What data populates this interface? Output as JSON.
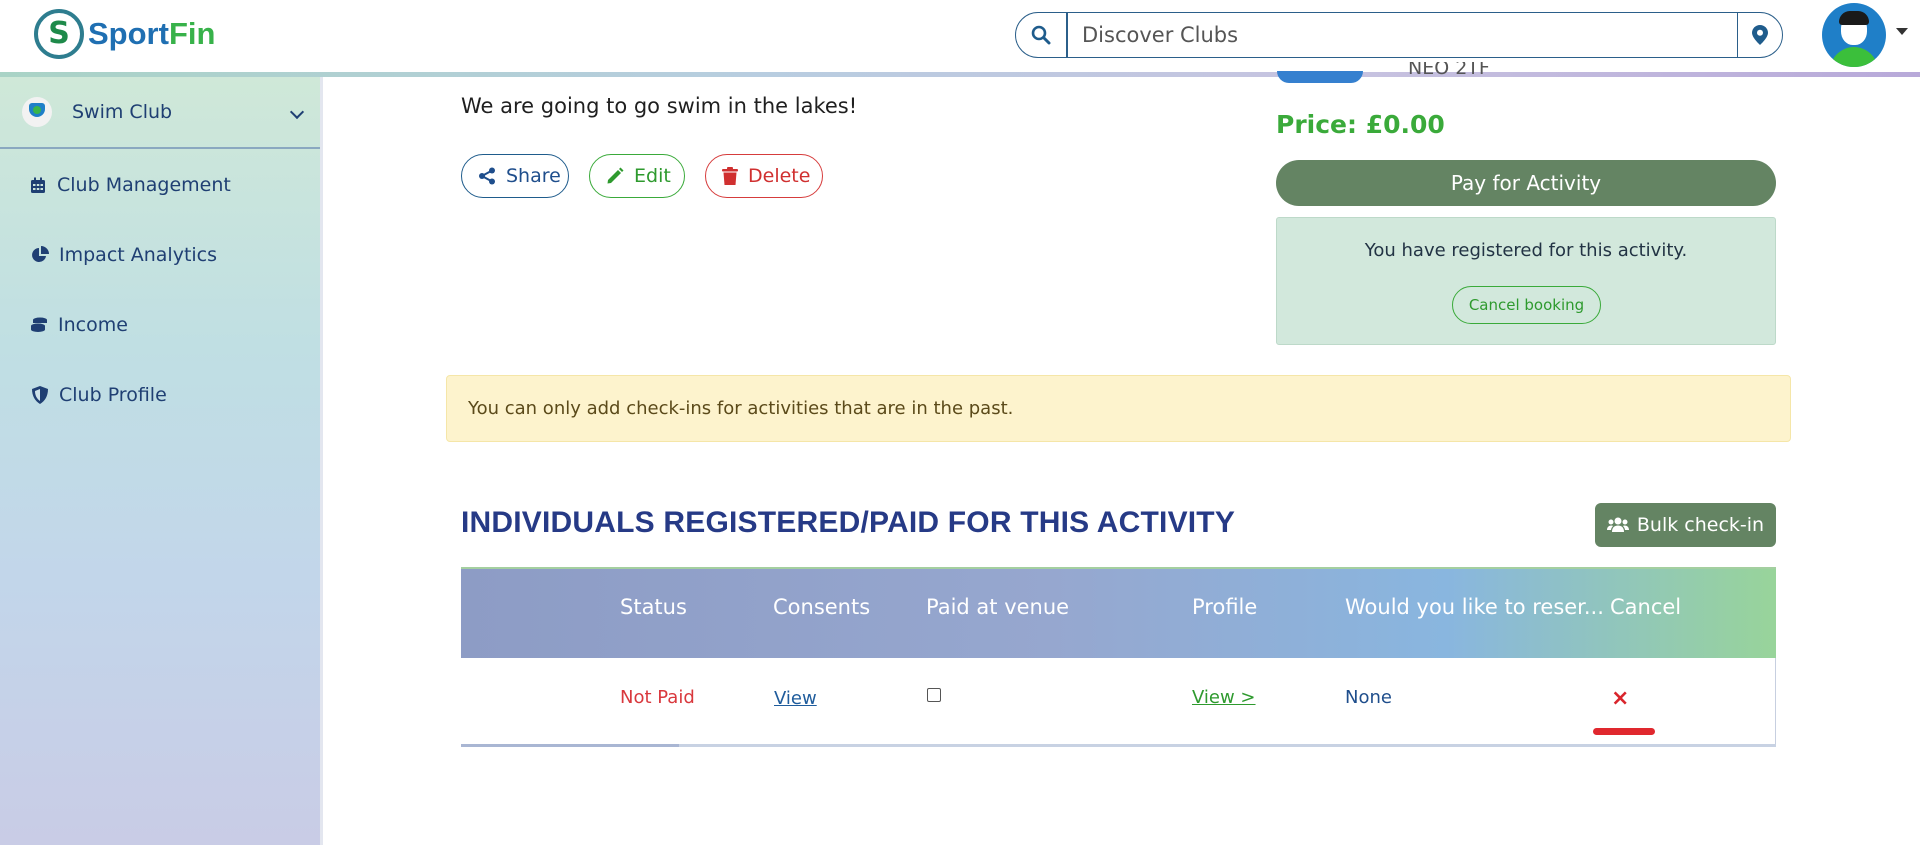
{
  "header": {
    "logo_part1": "Sport",
    "logo_part2": "Fin",
    "search_placeholder": "Discover Clubs"
  },
  "sidebar": {
    "club_name": "Swim Club",
    "items": [
      {
        "label": "Club Management",
        "icon": "calendar-icon"
      },
      {
        "label": "Impact Analytics",
        "icon": "pie-chart-icon"
      },
      {
        "label": "Income",
        "icon": "coins-icon"
      },
      {
        "label": "Club Profile",
        "icon": "shield-icon"
      }
    ]
  },
  "activity": {
    "description": "We are going to go swim in the lakes!",
    "partial_text": "NEO 2TF",
    "share_label": "Share",
    "edit_label": "Edit",
    "delete_label": "Delete",
    "price": "Price: £0.00",
    "pay_label": "Pay for Activity",
    "registered_message": "You have registered for this activity.",
    "cancel_booking_label": "Cancel booking"
  },
  "warning": "You can only add check-ins for activities that are in the past.",
  "registrations": {
    "title": "INDIVIDUALS REGISTERED/PAID FOR THIS ACTIVITY",
    "bulk_checkin_label": "Bulk check-in",
    "columns": [
      "Status",
      "Consents",
      "Paid at venue",
      "Profile",
      "Would you like to reser...",
      "Cancel"
    ],
    "rows": [
      {
        "status": "Not Paid",
        "consents": "View",
        "paid_at_venue": false,
        "profile": "View >",
        "reserve": "None",
        "cancel": "×"
      }
    ]
  },
  "colors": {
    "primary_green": "#648463",
    "accent_green": "#3aaa3a",
    "navy": "#263a86",
    "danger": "#d9383d",
    "warning_bg": "#fdf3cd"
  }
}
